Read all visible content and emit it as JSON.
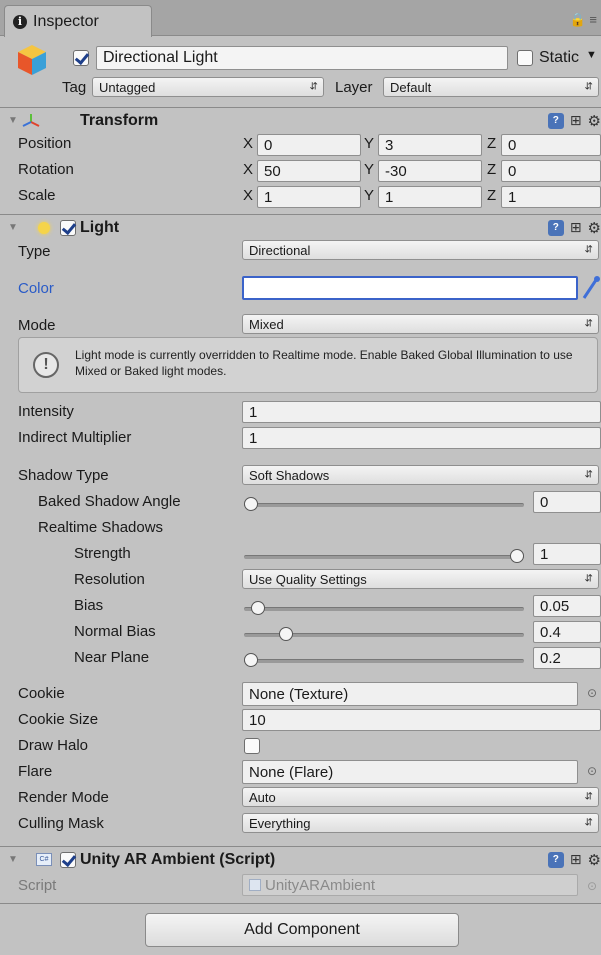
{
  "tab": {
    "label": "Inspector",
    "info_icon": "info-icon"
  },
  "object": {
    "enabled": true,
    "name": "Directional Light",
    "static_label": "Static",
    "tag_label": "Tag",
    "tag_value": "Untagged",
    "layer_label": "Layer",
    "layer_value": "Default"
  },
  "transform": {
    "title": "Transform",
    "position_label": "Position",
    "rotation_label": "Rotation",
    "scale_label": "Scale",
    "axes": {
      "x": "X",
      "y": "Y",
      "z": "Z"
    },
    "position": {
      "x": "0",
      "y": "3",
      "z": "0"
    },
    "rotation": {
      "x": "50",
      "y": "-30",
      "z": "0"
    },
    "scale": {
      "x": "1",
      "y": "1",
      "z": "1"
    }
  },
  "light": {
    "title": "Light",
    "enabled": true,
    "type_label": "Type",
    "type_value": "Directional",
    "color_label": "Color",
    "color_value": "#ffffff",
    "mode_label": "Mode",
    "mode_value": "Mixed",
    "help_text": "Light mode is currently overridden to Realtime mode. Enable Baked Global Illumination to use Mixed or Baked light modes.",
    "intensity_label": "Intensity",
    "intensity_value": "1",
    "indirect_label": "Indirect Multiplier",
    "indirect_value": "1",
    "shadow_type_label": "Shadow Type",
    "shadow_type_value": "Soft Shadows",
    "baked_angle_label": "Baked Shadow Angle",
    "baked_angle_value": "0",
    "baked_angle_fraction": 0.0,
    "realtime_label": "Realtime Shadows",
    "strength_label": "Strength",
    "strength_value": "1",
    "strength_fraction": 1.0,
    "resolution_label": "Resolution",
    "resolution_value": "Use Quality Settings",
    "bias_label": "Bias",
    "bias_value": "0.05",
    "bias_fraction": 0.025,
    "normal_bias_label": "Normal Bias",
    "normal_bias_value": "0.4",
    "normal_bias_fraction": 0.133,
    "near_plane_label": "Near Plane",
    "near_plane_value": "0.2",
    "near_plane_fraction": 0.0,
    "cookie_label": "Cookie",
    "cookie_value": "None (Texture)",
    "cookie_size_label": "Cookie Size",
    "cookie_size_value": "10",
    "draw_halo_label": "Draw Halo",
    "draw_halo_checked": false,
    "flare_label": "Flare",
    "flare_value": "None (Flare)",
    "render_mode_label": "Render Mode",
    "render_mode_value": "Auto",
    "culling_label": "Culling Mask",
    "culling_value": "Everything"
  },
  "script_component": {
    "title": "Unity AR Ambient (Script)",
    "enabled": true,
    "script_label": "Script",
    "script_value": "UnityARAmbient"
  },
  "add_component_label": "Add Component",
  "colors": {
    "panel": "#c2c2c2",
    "color_label_blue": "#2a5bc7",
    "eyedropper": "#3f6fd8"
  }
}
